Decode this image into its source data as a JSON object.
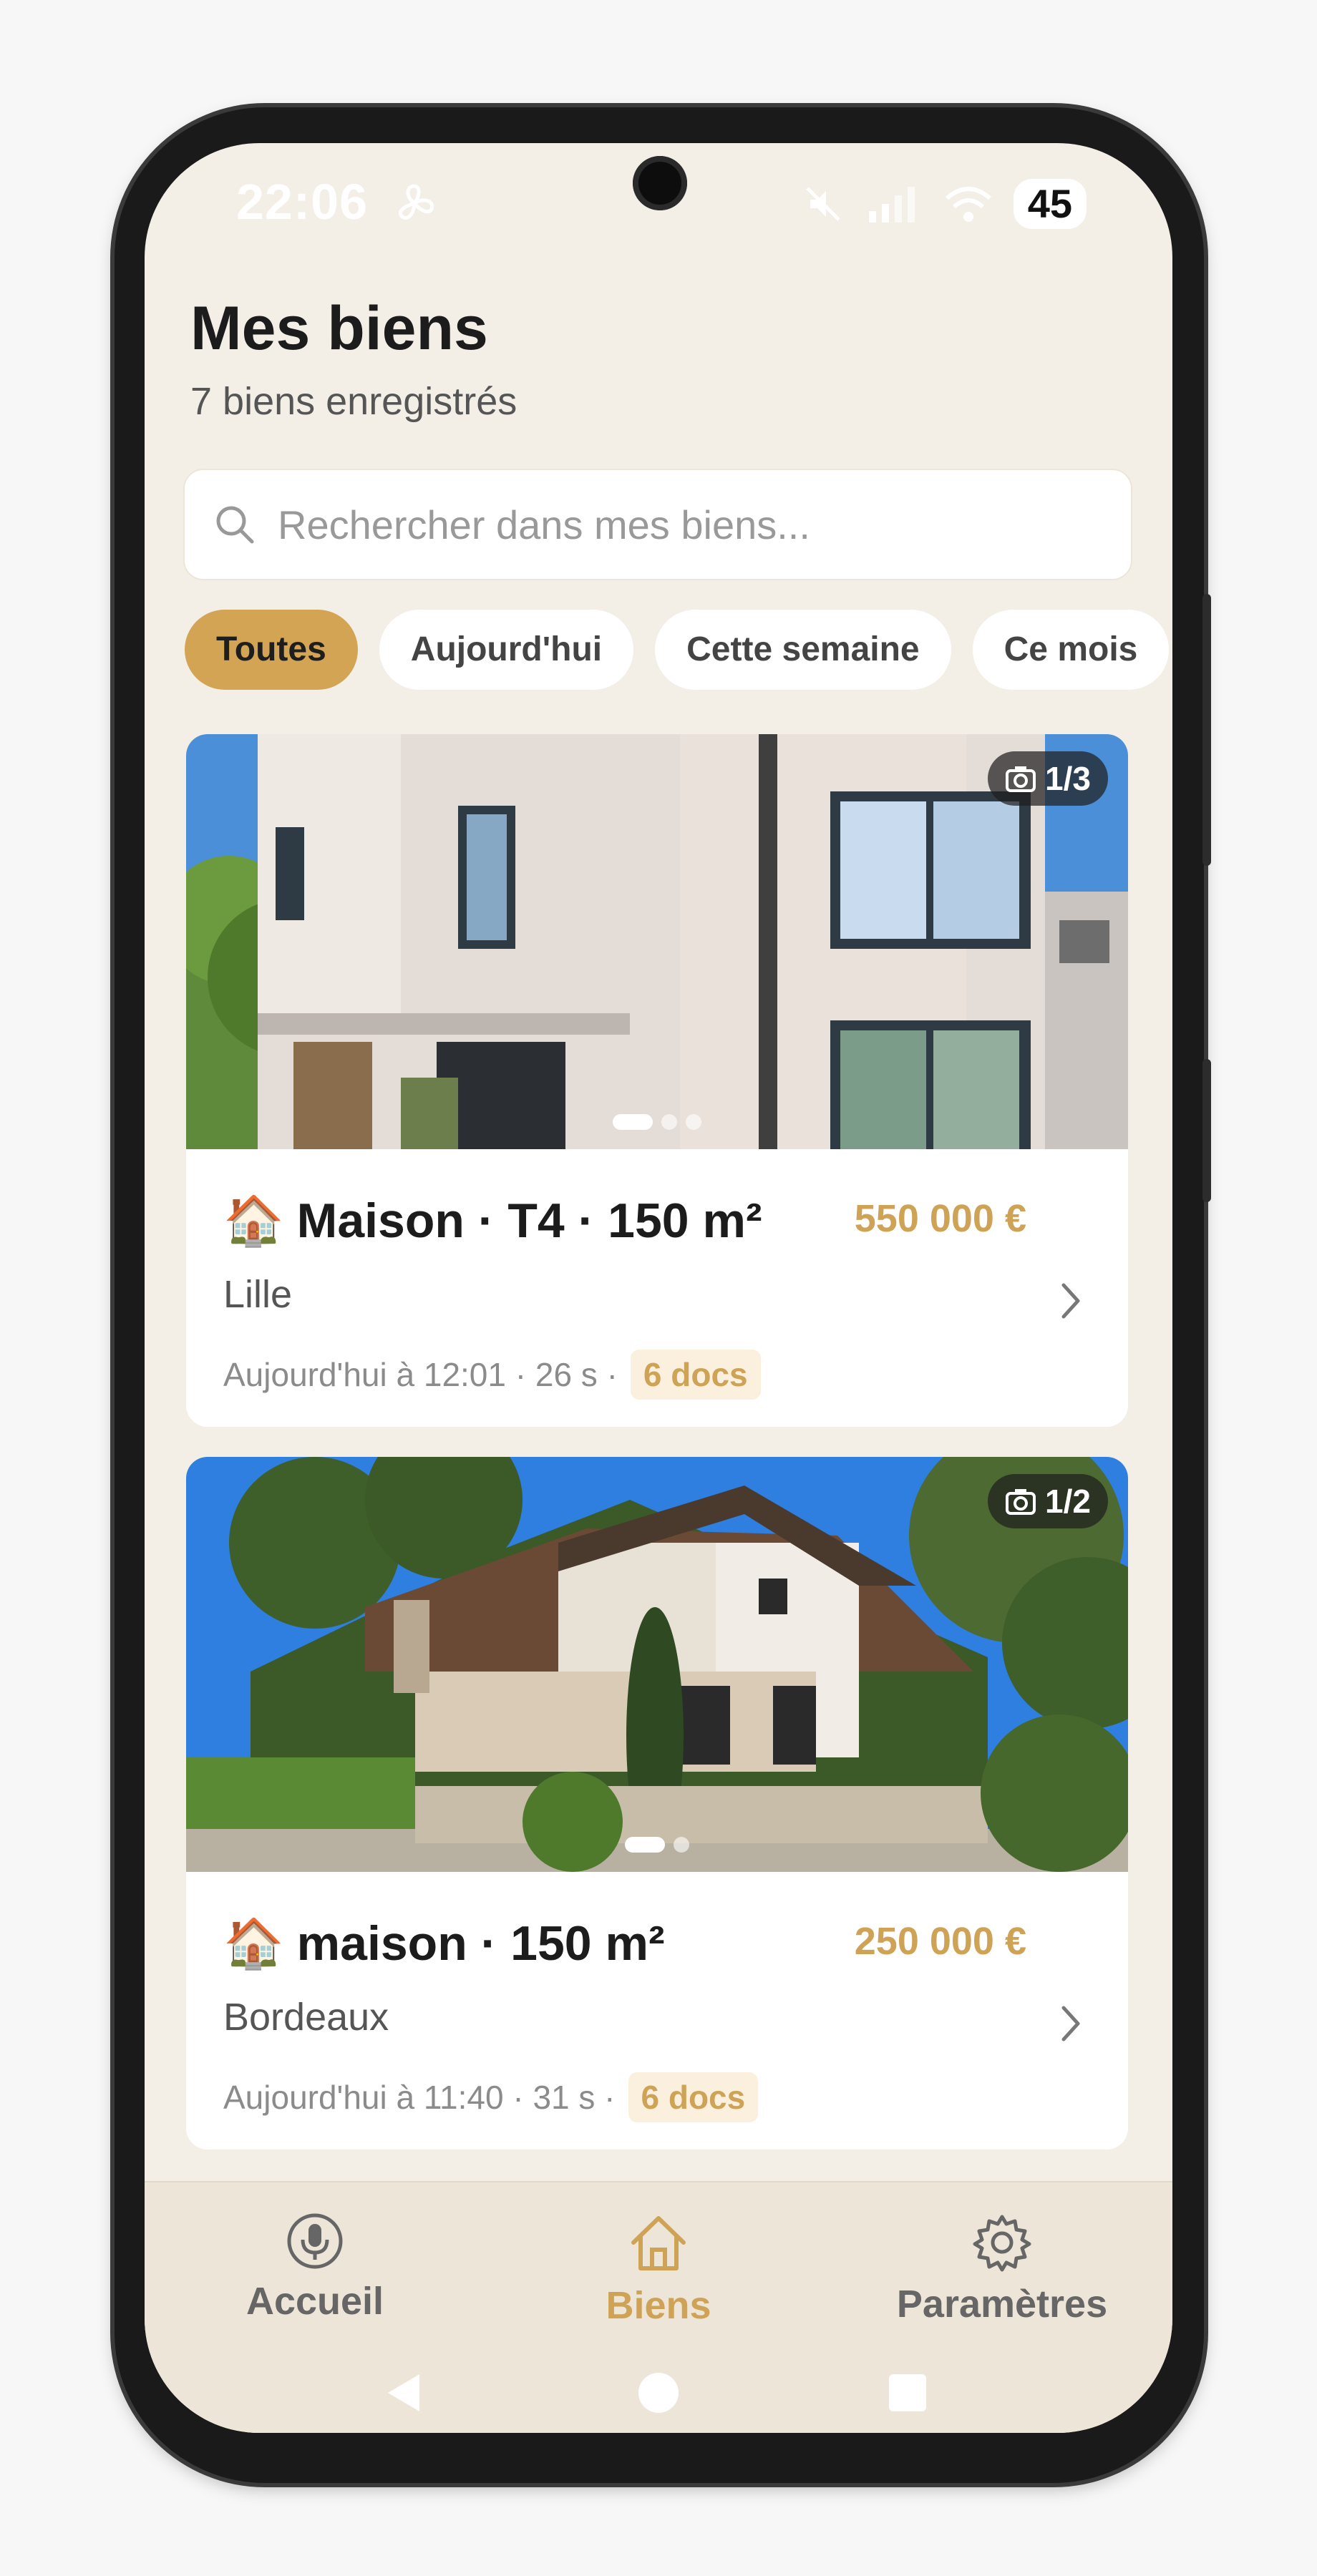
{
  "status_bar": {
    "time": "22:06",
    "battery": "45"
  },
  "header": {
    "title": "Mes biens",
    "subtitle": "7 biens enregistrés"
  },
  "search": {
    "placeholder": "Rechercher dans mes biens..."
  },
  "filters": [
    {
      "label": "Toutes",
      "active": true
    },
    {
      "label": "Aujourd'hui",
      "active": false
    },
    {
      "label": "Cette semaine",
      "active": false
    },
    {
      "label": "Ce mois",
      "active": false
    }
  ],
  "properties": [
    {
      "emoji": "🏠",
      "title": "Maison · T4 · 150 m²",
      "price": "550 000 €",
      "city": "Lille",
      "meta": "Aujourd'hui à 12:01 · 26 s ·",
      "docs": "6 docs",
      "photo_counter": "1/3"
    },
    {
      "emoji": "🏠",
      "title": "maison · 150 m²",
      "price": "250 000 €",
      "city": "Bordeaux",
      "meta": "Aujourd'hui à 11:40 · 31 s ·",
      "docs": "6 docs",
      "photo_counter": "1/2"
    }
  ],
  "bottom_nav": [
    {
      "label": "Accueil",
      "icon": "microphone-icon",
      "active": false
    },
    {
      "label": "Biens",
      "icon": "home-icon",
      "active": true
    },
    {
      "label": "Paramètres",
      "icon": "gear-icon",
      "active": false
    }
  ],
  "colors": {
    "accent": "#cea356",
    "background": "#f3efe7",
    "nav_background": "#ede5d7"
  }
}
